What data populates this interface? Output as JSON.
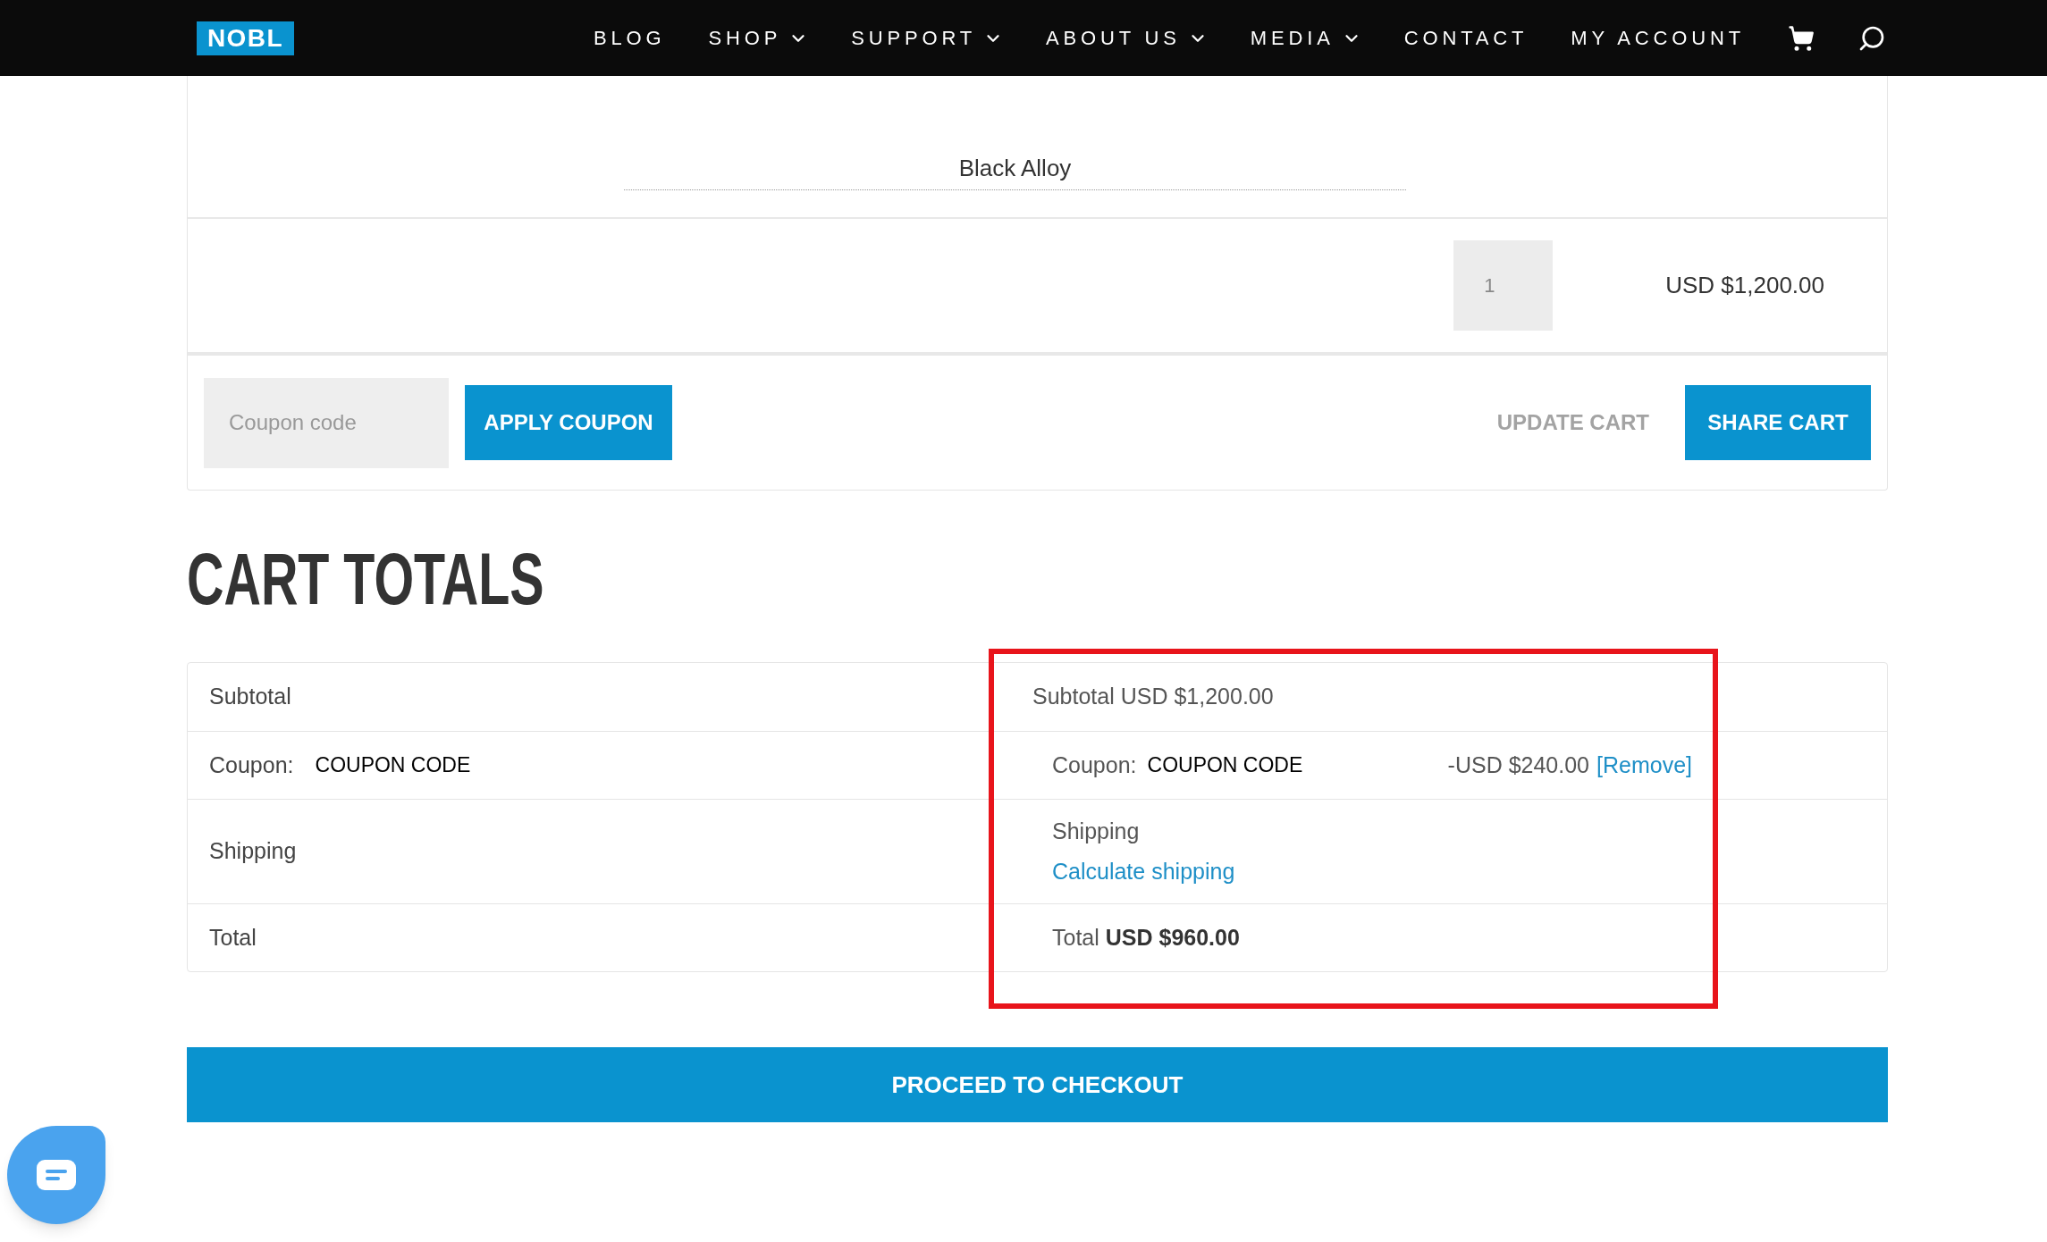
{
  "header": {
    "logo": "NOBL",
    "nav": [
      {
        "label": "BLOG",
        "dropdown": false
      },
      {
        "label": "SHOP",
        "dropdown": true
      },
      {
        "label": "SUPPORT",
        "dropdown": true
      },
      {
        "label": "ABOUT US",
        "dropdown": true
      },
      {
        "label": "MEDIA",
        "dropdown": true
      },
      {
        "label": "CONTACT",
        "dropdown": false
      },
      {
        "label": "MY ACCOUNT",
        "dropdown": false
      }
    ]
  },
  "cart": {
    "variant": "Black Alloy",
    "quantity": "1",
    "line_total": "USD $1,200.00",
    "coupon_placeholder": "Coupon code",
    "apply_button": "APPLY COUPON",
    "update_button": "UPDATE CART",
    "update_disabled": true,
    "share_button": "SHARE CART"
  },
  "totals": {
    "title": "CART TOTALS",
    "rows": [
      {
        "kind": "subtotal",
        "label": "Subtotal",
        "value_label": "Subtotal",
        "value": "USD $1,200.00"
      },
      {
        "kind": "coupon",
        "label": "Coupon:",
        "code": "COUPON CODE",
        "value_label": "Coupon:",
        "value_code": "COUPON CODE",
        "value": "-USD $240.00",
        "link": "[Remove]"
      },
      {
        "kind": "shipping",
        "label": "Shipping",
        "value_label": "Shipping",
        "link": "Calculate shipping"
      },
      {
        "kind": "total",
        "label": "Total",
        "value_label": "Total",
        "value": "USD $960.00"
      }
    ]
  },
  "checkout_button": "PROCEED TO CHECKOUT"
}
